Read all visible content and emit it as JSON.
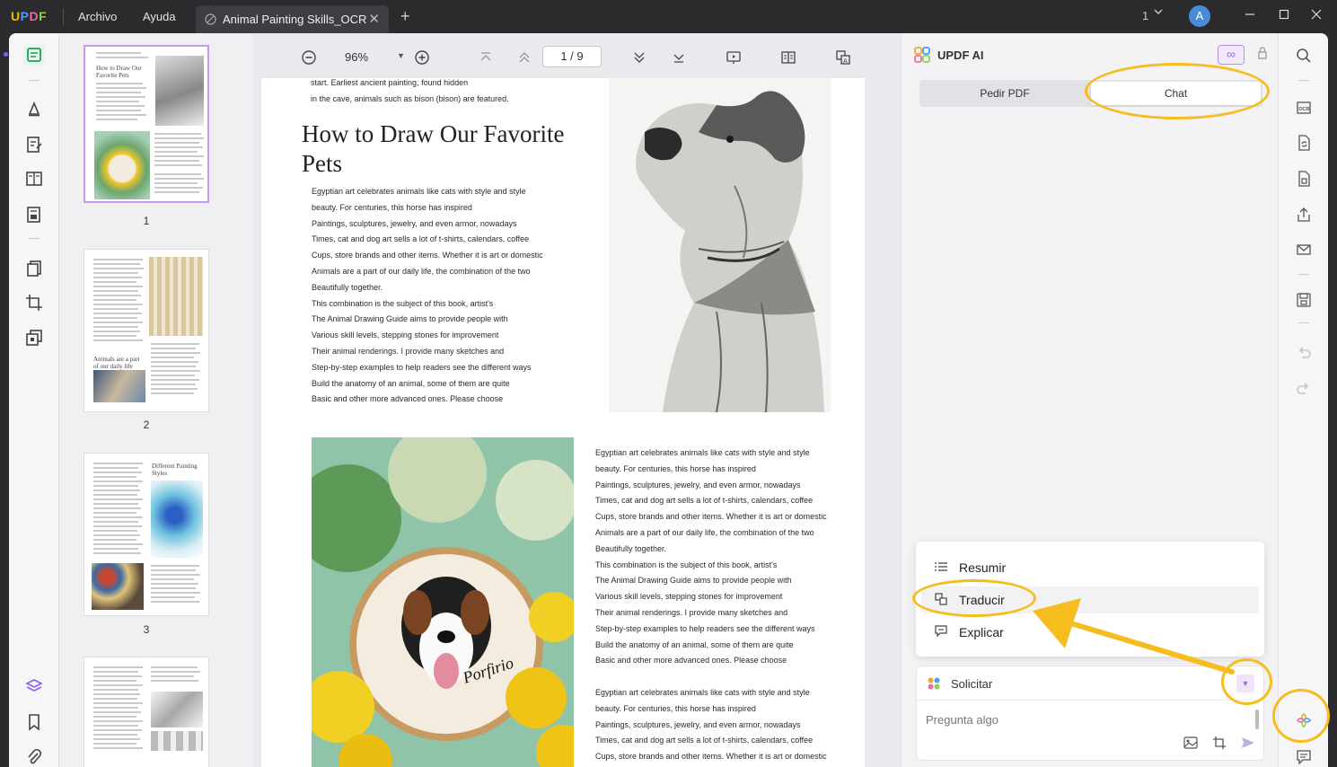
{
  "app": {
    "logo": "UPDF",
    "menu": [
      "Archivo",
      "Ayuda"
    ],
    "tab_title": "Animal Painting Skills_OCR",
    "window_count": "1",
    "user_initial": "A"
  },
  "toolbar": {
    "zoom": "96%",
    "page_indicator": "1 / 9"
  },
  "thumbnails": {
    "pages": [
      "1",
      "2",
      "3"
    ],
    "page1_title": "How to Draw Our Favorite Pets",
    "page2_caption": "Animals are a part of our daily life",
    "page3_title": "Different Painting Styles"
  },
  "document": {
    "top_lines": [
      "start. Earliest ancient painting, found hidden",
      "in the cave, animals such as bison (bison) are featured."
    ],
    "title": "How to Draw Our Favorite Pets",
    "body_left": [
      "Egyptian art celebrates animals like cats with style and style",
      "beauty. For centuries, this horse has inspired",
      "Paintings, sculptures, jewelry, and even armor, nowadays",
      "Times, cat and dog art sells a lot of t-shirts, calendars, coffee",
      "Cups, store brands and other items. Whether it is art or domestic",
      "Animals are a part of our daily life, the combination of the two",
      "Beautifully together.",
      "This combination is the subject of this book, artist's",
      "The Animal Drawing Guide aims to provide people with",
      "Various skill levels, stepping stones for improvement",
      "Their animal renderings. I provide many sketches and",
      "Step-by-step examples to help readers see the different ways",
      "Build the anatomy of an animal, some of them are quite",
      "Basic and other more advanced ones. Please choose"
    ],
    "body_right": [
      "Egyptian art celebrates animals like cats with style and style",
      "beauty. For centuries, this horse has inspired",
      "Paintings, sculptures, jewelry, and even armor, nowadays",
      "Times, cat and dog art sells a lot of t-shirts, calendars, coffee",
      "Cups, store brands and other items. Whether it is art or domestic",
      "Animals are a part of our daily life, the combination of the two",
      "Beautifully together.",
      "This combination is the subject of this book, artist's",
      "The Animal Drawing Guide aims to provide people with",
      "Various skill levels, stepping stones for improvement",
      "Their animal renderings. I provide many sketches and",
      "Step-by-step examples to help readers see the different ways",
      "Build the anatomy of an animal, some of them are quite",
      "Basic and other more advanced ones. Please choose"
    ],
    "body_right_2": [
      "Egyptian art celebrates animals like cats with style and style",
      "beauty. For centuries, this horse has inspired",
      "Paintings, sculptures, jewelry, and even armor, nowadays",
      "Times, cat and dog art sells a lot of t-shirts, calendars, coffee",
      "Cups, store brands and other items. Whether it is art or domestic"
    ],
    "embroidery_text": "Porfirio"
  },
  "ai_panel": {
    "title": "UPDF AI",
    "infinity": "∞",
    "tabs": [
      "Pedir PDF",
      "Chat"
    ],
    "active_tab": "Chat",
    "prompt_menu": [
      "Resumir",
      "Traducir",
      "Explicar"
    ],
    "solicitar_label": "Solicitar",
    "ask_placeholder": "Pregunta algo"
  },
  "colors": {
    "accent_purple": "#9b6be0",
    "highlight_yellow": "#f5bd1f",
    "titlebar": "#2b2b2e"
  }
}
